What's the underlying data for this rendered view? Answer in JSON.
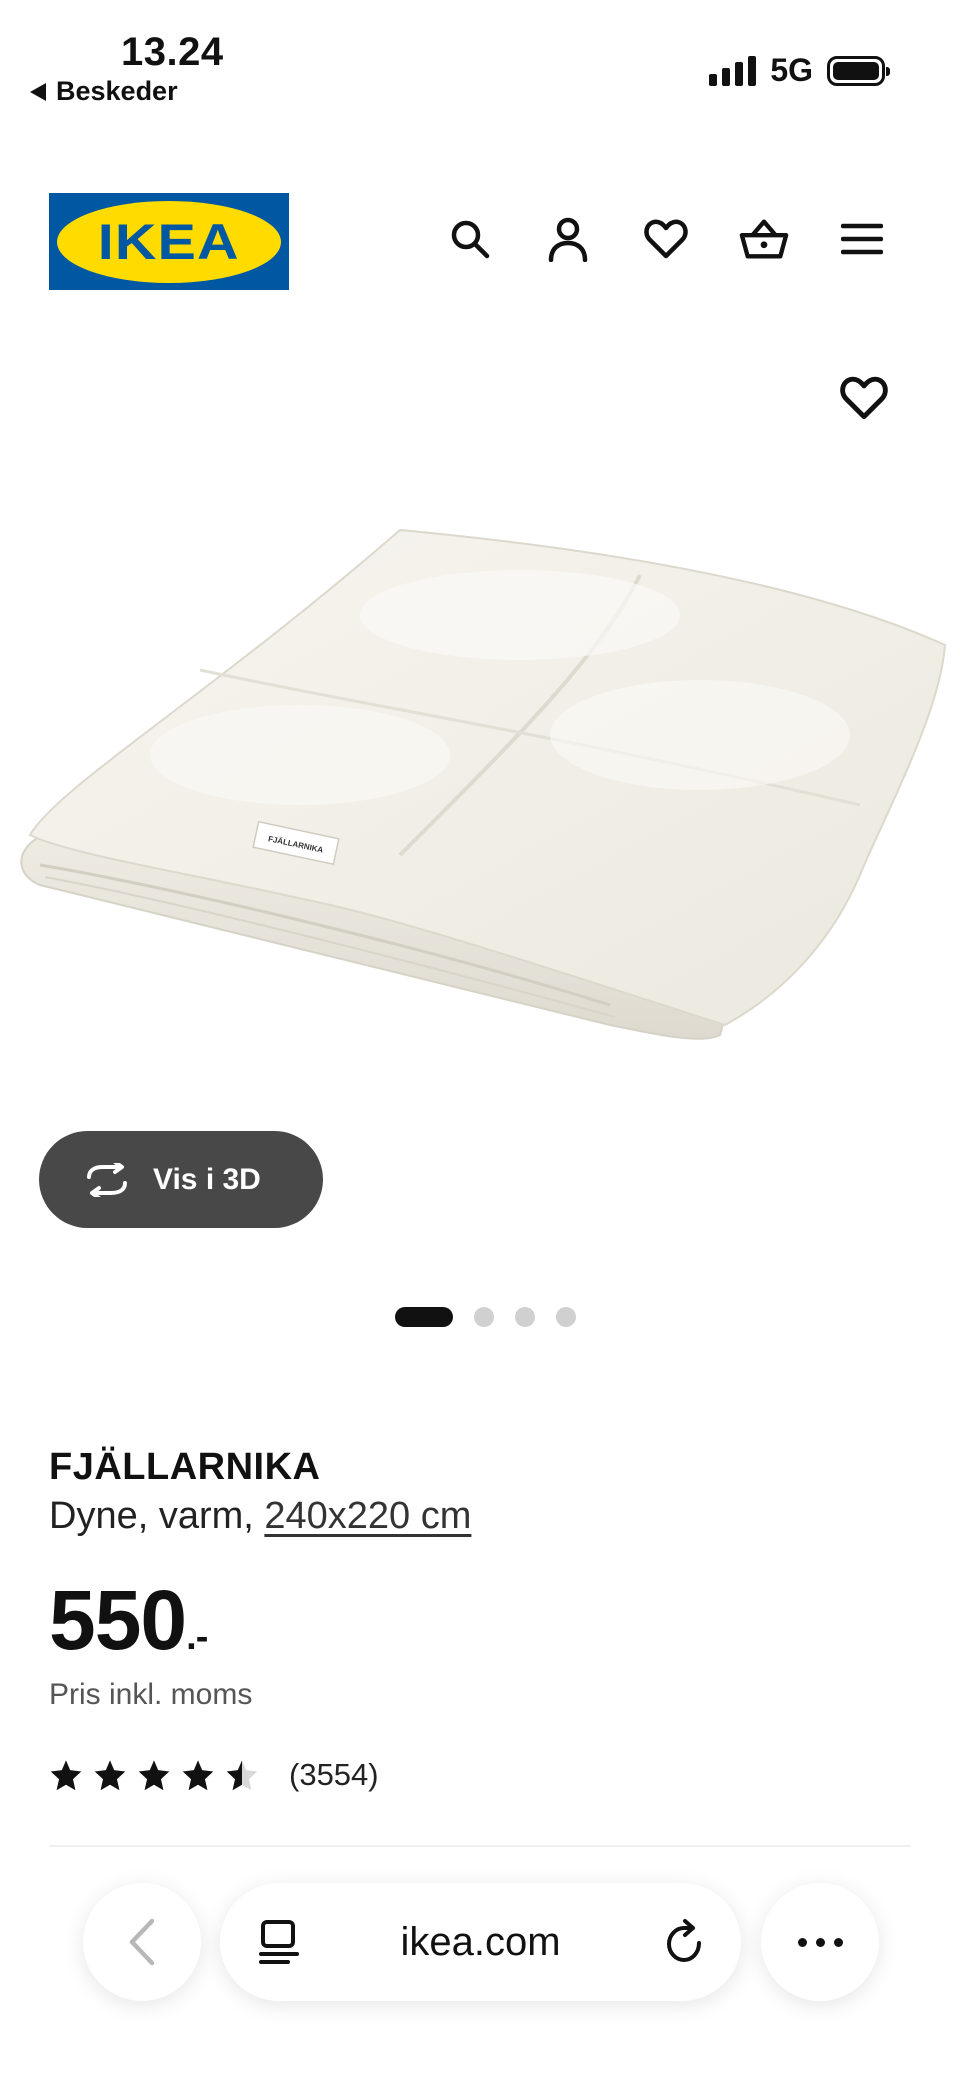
{
  "status_bar": {
    "time": "13.24",
    "back_app": "Beskeder",
    "network": "5G"
  },
  "header": {
    "logo_text": "IKEA",
    "icons": [
      "search-icon",
      "account-icon",
      "favourites-icon",
      "basket-icon",
      "menu-icon"
    ]
  },
  "gallery": {
    "view3d_label": "Vis i 3D",
    "image_count": 4,
    "active_index": 0,
    "label_on_product": "FJÄLLARNIKA"
  },
  "product": {
    "name": "FJÄLLARNIKA",
    "description": "Dyne, varm, ",
    "size": "240x220 cm",
    "price": "550",
    "price_suffix": ".-",
    "vat_note": "Pris inkl. moms",
    "rating": 4.5,
    "review_count": "(3554)"
  },
  "browser": {
    "url": "ikea.com"
  },
  "colors": {
    "ikea_blue": "#0058a3",
    "ikea_yellow": "#ffdb00",
    "view3d_bg": "#484848"
  }
}
